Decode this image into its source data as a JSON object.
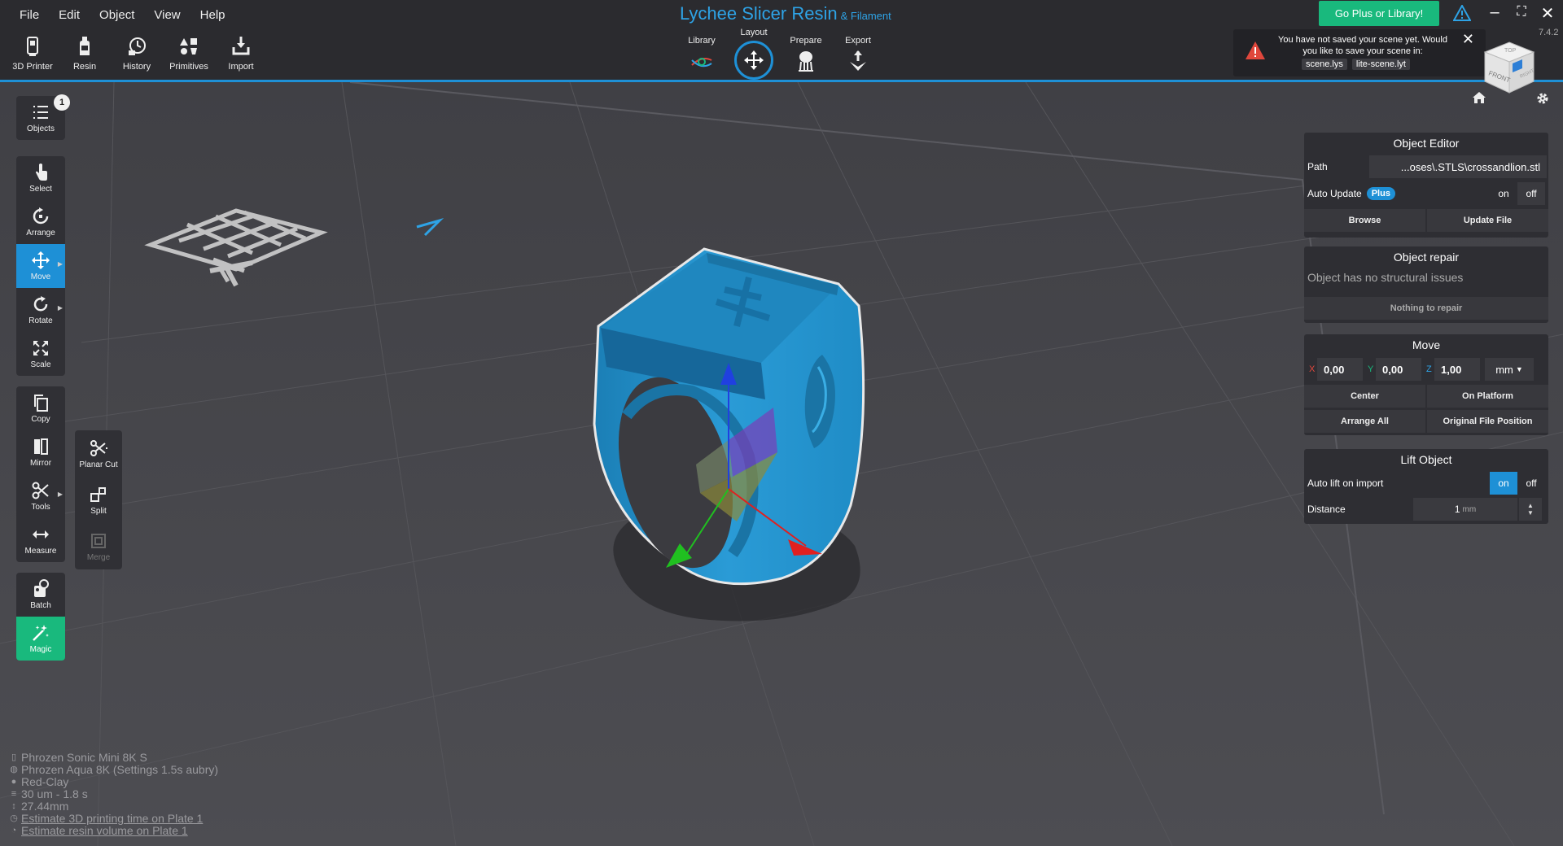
{
  "menu": [
    "File",
    "Edit",
    "Object",
    "View",
    "Help"
  ],
  "top_tools": [
    {
      "label": "3D Printer",
      "icon": "printer-icon"
    },
    {
      "label": "Resin",
      "icon": "resin-bottle-icon"
    },
    {
      "label": "History",
      "icon": "history-icon"
    },
    {
      "label": "Primitives",
      "icon": "primitives-icon"
    },
    {
      "label": "Import",
      "icon": "import-icon"
    }
  ],
  "title": {
    "main": "Lychee Slicer Resin",
    "sub": "& Filament"
  },
  "modes": [
    {
      "label": "Library",
      "icon": "library-icon"
    },
    {
      "label": "Layout",
      "icon": "move-arrows-icon",
      "active": true
    },
    {
      "label": "Prepare",
      "icon": "supports-icon"
    },
    {
      "label": "Export",
      "icon": "export-icon"
    }
  ],
  "go_plus_label": "Go Plus or Library!",
  "version": "7.4.2",
  "notification": {
    "message": "You have not saved your scene yet. Would you like to save your scene in:",
    "options": [
      "scene.lys",
      "lite-scene.lyt"
    ]
  },
  "viewcube": {
    "top": "TOP",
    "front": "FRONT",
    "right": "RIGHT"
  },
  "objects_count": "1",
  "left_tools": {
    "objects": "Objects",
    "select": "Select",
    "arrange": "Arrange",
    "move": "Move",
    "rotate": "Rotate",
    "scale": "Scale",
    "copy": "Copy",
    "mirror": "Mirror",
    "tools": "Tools",
    "measure": "Measure",
    "batch": "Batch",
    "magic": "Magic"
  },
  "sub_tools": {
    "planar_cut": "Planar Cut",
    "split": "Split",
    "merge": "Merge"
  },
  "object_editor": {
    "title": "Object Editor",
    "path_label": "Path",
    "path_value": "...oses\\.STLS\\crossandlion.stl",
    "auto_update_label": "Auto Update",
    "plus": "Plus",
    "on": "on",
    "off": "off",
    "browse": "Browse",
    "update_file": "Update File"
  },
  "object_repair": {
    "title": "Object repair",
    "status": "Object has no structural issues",
    "button": "Nothing to repair"
  },
  "move": {
    "title": "Move",
    "x_label": "X",
    "x": "0,00",
    "y_label": "Y",
    "y": "0,00",
    "z_label": "Z",
    "z": "1,00",
    "unit": "mm",
    "center": "Center",
    "on_platform": "On Platform",
    "arrange_all": "Arrange All",
    "original_position": "Original File Position"
  },
  "lift_object": {
    "title": "Lift Object",
    "auto_lift_label": "Auto lift on import",
    "on": "on",
    "off": "off",
    "distance_label": "Distance",
    "distance_value": "1",
    "distance_unit": "mm"
  },
  "info": {
    "printer": "Phrozen Sonic Mini 8K S",
    "resin": "Phrozen Aqua 8K (Settings 1.5s aubry)",
    "color": "Red-Clay",
    "layer": "30 um - 1.8 s",
    "height": "27.44mm",
    "estimate_time": "Estimate 3D printing time on Plate 1",
    "estimate_volume": "Estimate resin volume on Plate 1"
  }
}
